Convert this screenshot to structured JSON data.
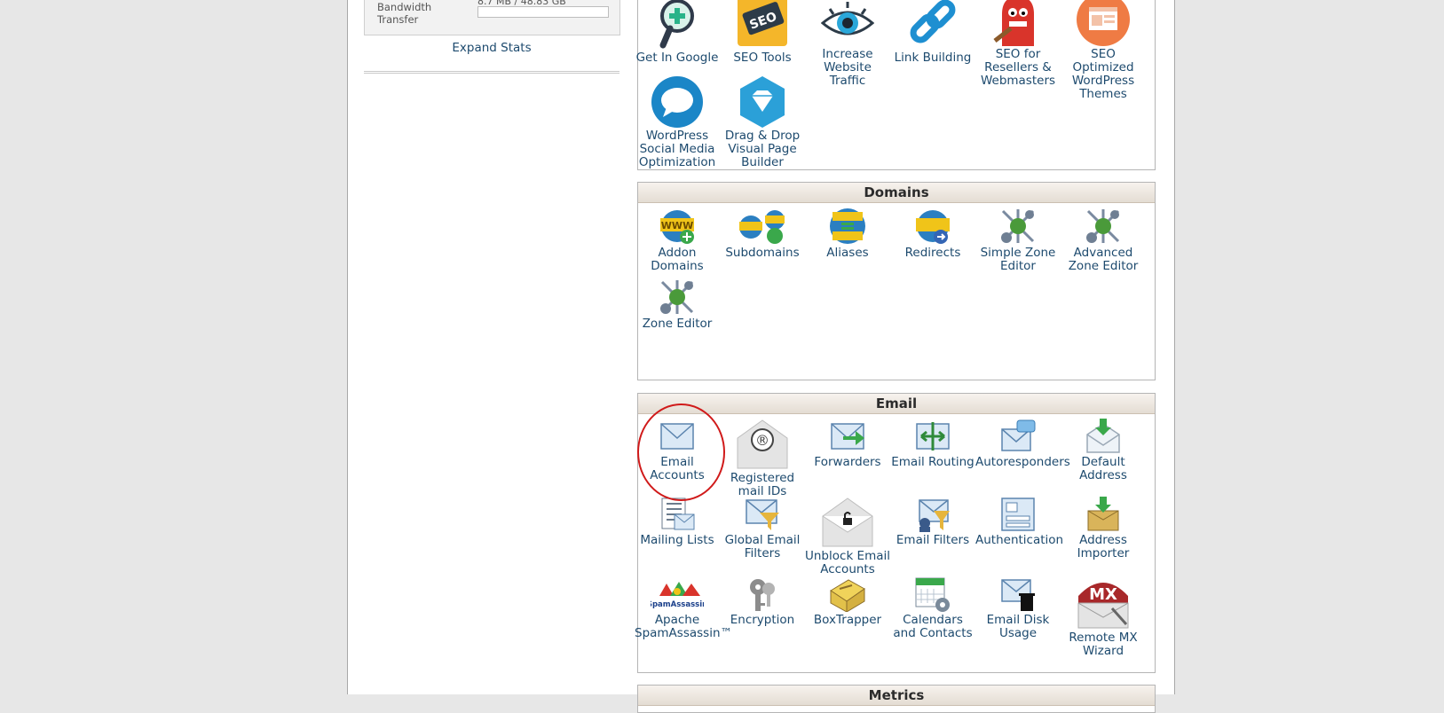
{
  "sidebar": {
    "bandwidth_label": "Bandwidth Transfer",
    "bandwidth_value": "8.7 MB / 48.83 GB",
    "expand_stats": "Expand Stats"
  },
  "seo": {
    "items": [
      {
        "label": "Get In Google"
      },
      {
        "label": "SEO Tools"
      },
      {
        "label": "Increase Website Traffic"
      },
      {
        "label": "Link Building"
      },
      {
        "label": "SEO for Resellers & Webmasters"
      },
      {
        "label": "SEO Optimized WordPress Themes"
      },
      {
        "label": "WordPress Social Media Optimization"
      },
      {
        "label": "Drag & Drop Visual Page Builder"
      }
    ],
    "seo_badge": "SEO"
  },
  "domains": {
    "title": "Domains",
    "items": [
      {
        "label": "Addon Domains"
      },
      {
        "label": "Subdomains"
      },
      {
        "label": "Aliases"
      },
      {
        "label": "Redirects"
      },
      {
        "label": "Simple Zone Editor"
      },
      {
        "label": "Advanced Zone Editor"
      },
      {
        "label": "Zone Editor"
      }
    ],
    "www": "WWW"
  },
  "email": {
    "title": "Email",
    "items": [
      {
        "label": "Email Accounts"
      },
      {
        "label": "Registered mail IDs"
      },
      {
        "label": "Forwarders"
      },
      {
        "label": "Email Routing"
      },
      {
        "label": "Autoresponders"
      },
      {
        "label": "Default Address"
      },
      {
        "label": "Mailing Lists"
      },
      {
        "label": "Global Email Filters"
      },
      {
        "label": "Unblock Email Accounts"
      },
      {
        "label": "Email Filters"
      },
      {
        "label": "Authentication"
      },
      {
        "label": "Address Importer"
      },
      {
        "label": "Apache SpamAssassin™"
      },
      {
        "label": "Encryption"
      },
      {
        "label": "BoxTrapper"
      },
      {
        "label": "Calendars and Contacts"
      },
      {
        "label": "Email Disk Usage"
      },
      {
        "label": "Remote MX Wizard"
      }
    ],
    "registered_mark": "®",
    "spamassassin_logo": "SpamAssassin",
    "mx": "MX"
  },
  "metrics": {
    "title": "Metrics"
  },
  "colors": {
    "link": "#1d4a6e",
    "annotation": "#d01a1a"
  }
}
